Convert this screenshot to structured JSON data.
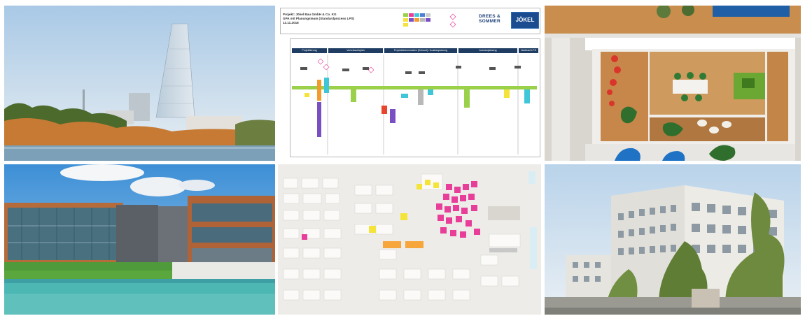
{
  "photos": [
    {
      "name": "tower-river-photo"
    },
    {
      "name": "process-chart-photo"
    },
    {
      "name": "office-aerial-photo"
    },
    {
      "name": "office-waterfront-photo"
    },
    {
      "name": "planning-board-photo"
    },
    {
      "name": "white-office-building-photo"
    }
  ],
  "process_chart": {
    "title_line1": "Projekt: Jökel Bau GmbH & Co. KG",
    "title_line2": "GPA mit Planungsteam (Standardprozess LPS)",
    "date": "12.11.2018",
    "logo_drees_line1": "DREES &",
    "logo_drees_line2": "SOMMER",
    "logo_jokel": "JÖKEL",
    "phases": [
      "Projektierung",
      "Vorentwurfsplan",
      "Projektdetermination (Entwurf) / Ausbauplanung",
      "Ausbauplanung",
      "Nachlauf LPS"
    ]
  },
  "colors": {
    "phase_bar": "#1f3c62",
    "note_green": "#9bd14a",
    "note_pink": "#e83e99",
    "note_yellow": "#f4e43a",
    "note_purple": "#7b4fc4",
    "note_cyan": "#3fc6d9"
  }
}
